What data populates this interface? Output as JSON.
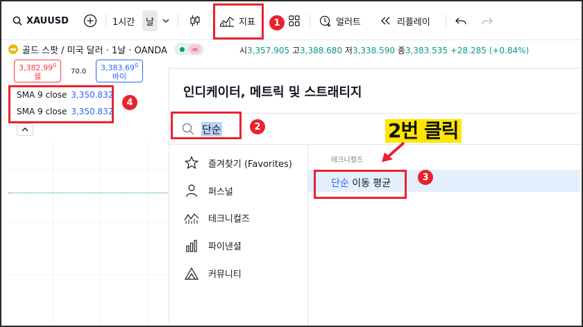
{
  "toolbar": {
    "symbol": "XAUUSD",
    "interval": "1시간",
    "interval_option": "날",
    "indicators_label": "지표",
    "alert_label": "얼러트",
    "replay_label": "리플레이"
  },
  "legend": {
    "title": "골드 스팟 / 미국 달러 · 1날 · OANDA",
    "open_label": "시",
    "open": "3,357.905",
    "high_label": "고",
    "high": "3,388.680",
    "low_label": "저",
    "low": "3,338.590",
    "close_label": "종",
    "close": "3,383.535",
    "change": "+28.285 (+0.84%)",
    "status_wave": "≈"
  },
  "trade": {
    "sell_price": "3,382.99",
    "sell_sup": "0",
    "sell_label": "셀",
    "spread": "70.0",
    "buy_price": "3,383.69",
    "buy_sup": "0",
    "buy_label": "바이"
  },
  "sma": [
    {
      "name": "SMA 9 close",
      "value": "3,350.832"
    },
    {
      "name": "SMA 9 close",
      "value": "3,350.832"
    }
  ],
  "dialog": {
    "title": "인디케이터, 메트릭 및 스트래티지",
    "search_value": "단순",
    "categories": [
      {
        "label": "즐겨찾기 (Favorites)",
        "icon": "star-icon"
      },
      {
        "label": "퍼스널",
        "icon": "person-icon"
      },
      {
        "label": "테크니컬즈",
        "icon": "technicals-icon"
      },
      {
        "label": "파이낸셜",
        "icon": "financials-icon"
      },
      {
        "label": "커뮤니티",
        "icon": "community-icon"
      }
    ],
    "section_label": "테크니컬즈",
    "result_match": "단순",
    "result_rest": " 이동 평균"
  },
  "annotations": {
    "badge1": "1",
    "badge2": "2",
    "badge3": "3",
    "badge4": "4",
    "callout": "2번 클릭"
  },
  "colors": {
    "highlight": "#e8232e",
    "accent": "#2962ff",
    "up": "#089981"
  }
}
